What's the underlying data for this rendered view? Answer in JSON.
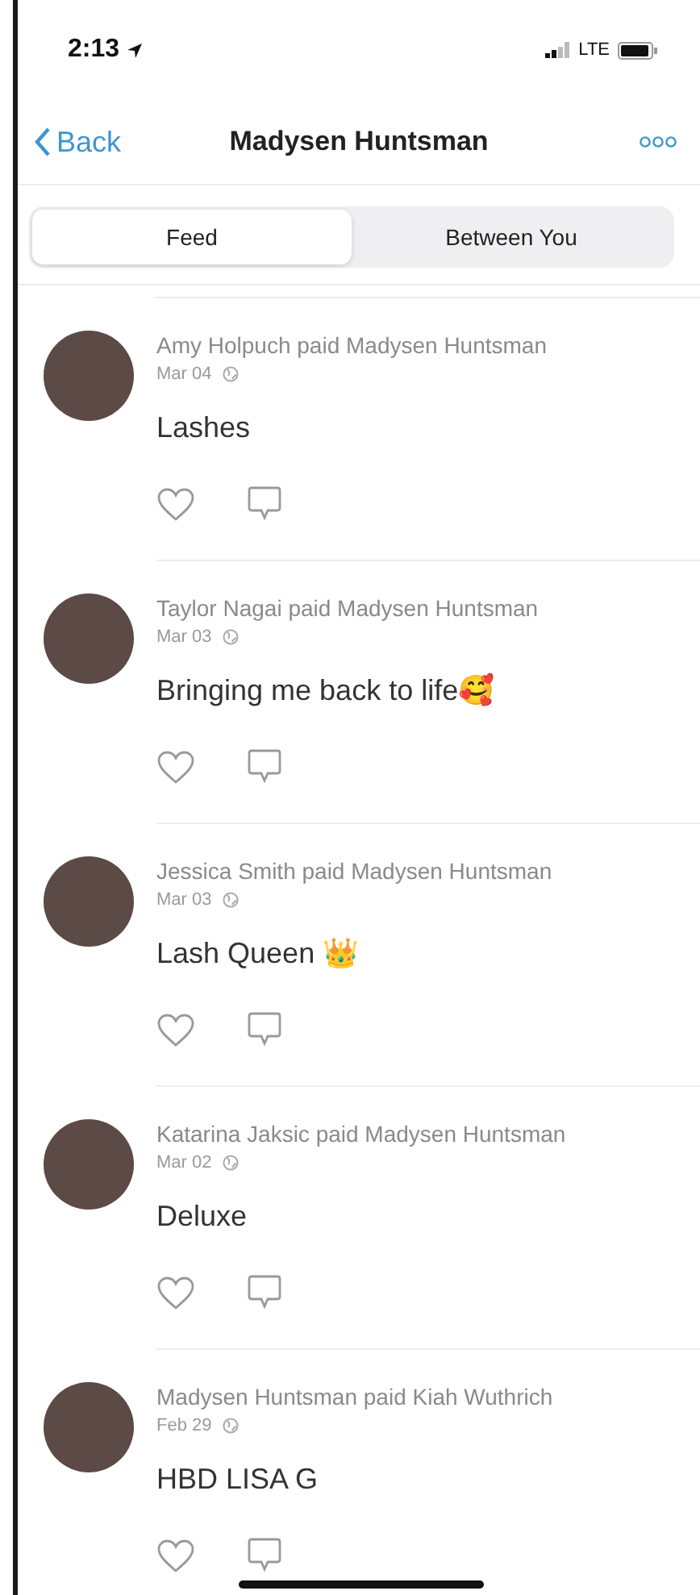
{
  "status_bar": {
    "time": "2:13",
    "network": "LTE"
  },
  "nav": {
    "back": "Back",
    "title": "Madysen Huntsman"
  },
  "tabs": [
    {
      "label": "Feed",
      "selected": true
    },
    {
      "label": "Between You",
      "selected": false
    }
  ],
  "feed": [
    {
      "title": "Amy Holpuch paid Madysen Huntsman",
      "date": "Mar 04",
      "note": "Lashes"
    },
    {
      "title": "Taylor Nagai paid Madysen Huntsman",
      "date": "Mar 03",
      "note": "Bringing me back to life🥰"
    },
    {
      "title": "Jessica Smith paid Madysen Huntsman",
      "date": "Mar 03",
      "note": "Lash Queen 👑"
    },
    {
      "title": "Katarina Jaksic paid Madysen Huntsman",
      "date": "Mar 02",
      "note": "Deluxe"
    },
    {
      "title": "Madysen Huntsman paid Kiah Wuthrich",
      "date": "Feb 29",
      "note": "HBD LISA G"
    }
  ]
}
